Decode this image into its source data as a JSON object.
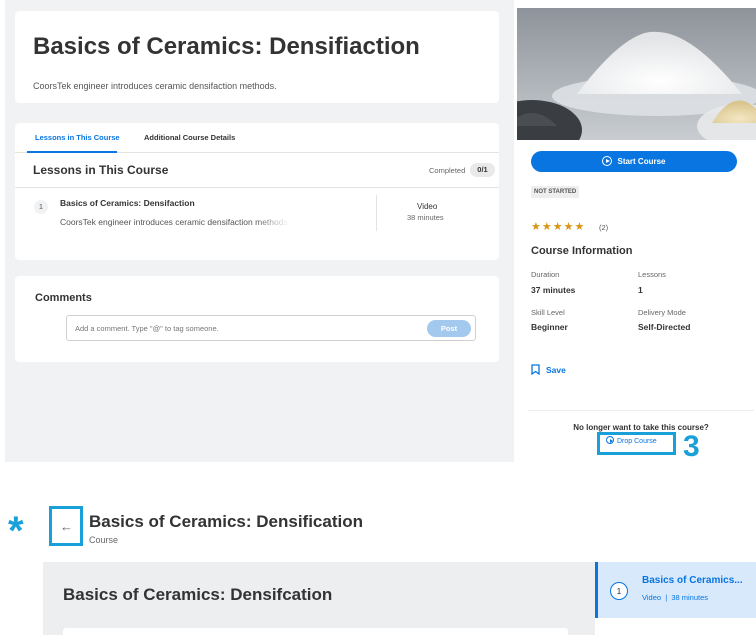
{
  "course_page": {
    "title": "Basics of Ceramics: Densifiaction",
    "description": "CoorsTek engineer introduces ceramic densifaction methods.",
    "tabs": [
      {
        "label": "Lessons in This Course"
      },
      {
        "label": "Additional Course Details"
      }
    ],
    "lessons_section": {
      "title": "Lessons in This Course",
      "completed_label": "Completed",
      "completed_count": "0/1",
      "lessons": [
        {
          "number": "1",
          "name": "Basics of Ceramics: Densifaction",
          "description": "CoorsTek engineer introduces ceramic densifaction methods.",
          "type": "Video",
          "duration": "38 minutes"
        }
      ]
    },
    "comments": {
      "title": "Comments",
      "placeholder": "Add a comment. Type \"@\" to tag someone.",
      "post_label": "Post"
    }
  },
  "sidebar": {
    "start_button": "Start Course",
    "status": "NOT STARTED",
    "stars": "★★★★★",
    "rating_count": "(2)",
    "info_title": "Course Information",
    "info": {
      "duration_label": "Duration",
      "duration_value": "37 minutes",
      "lessons_label": "Lessons",
      "lessons_value": "1",
      "skill_label": "Skill Level",
      "skill_value": "Beginner",
      "delivery_label": "Delivery Mode",
      "delivery_value": "Self-Directed"
    },
    "save_label": "Save",
    "drop_question": "No longer want to take this course?",
    "drop_button": "Drop Course",
    "step_number": "3"
  },
  "bottom_view": {
    "marker": "*",
    "back_arrow": "←",
    "title": "Basics of Ceramics: Densification",
    "subtitle": "Course",
    "main_title": "Basics of Ceramics: Densifcation",
    "side_item": {
      "number": "1",
      "title": "Basics of Ceramics...",
      "type": "Video",
      "separator": "|",
      "duration": "38 minutes"
    }
  },
  "colors": {
    "accent": "#0875e1",
    "annotation": "#1aa0d8",
    "star": "#d89614"
  }
}
